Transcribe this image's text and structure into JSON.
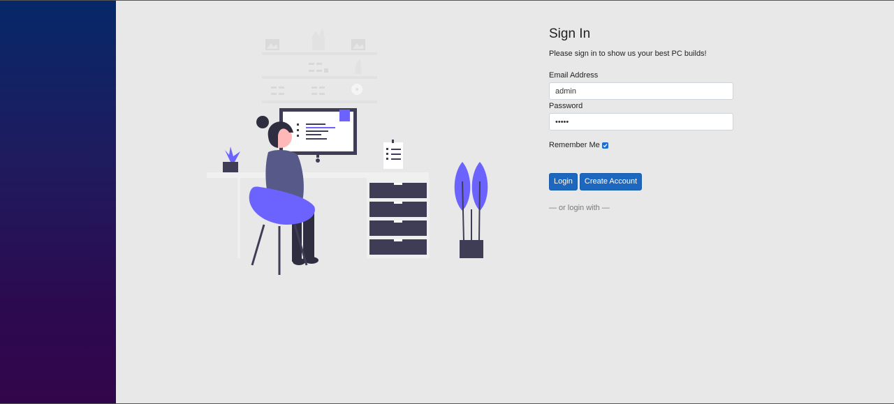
{
  "login": {
    "title": "Sign In",
    "subtitle": "Please sign in to show us your best PC builds!",
    "email_label": "Email Address",
    "email_value": "admin",
    "password_label": "Password",
    "password_value": "•••••",
    "remember_label": "Remember Me",
    "remember_checked": true,
    "login_button": "Login",
    "create_account_button": "Create Account",
    "alt_login_text": "— or login with —"
  },
  "colors": {
    "sidebar_top": "#062868",
    "sidebar_bottom": "#32054a",
    "background": "#e8e8e8",
    "accent_purple": "#6c63ff",
    "dark_slate": "#3f3d56",
    "button_blue": "#1d67bf"
  },
  "illustration": {
    "subject": "person-at-desk-illustration"
  }
}
